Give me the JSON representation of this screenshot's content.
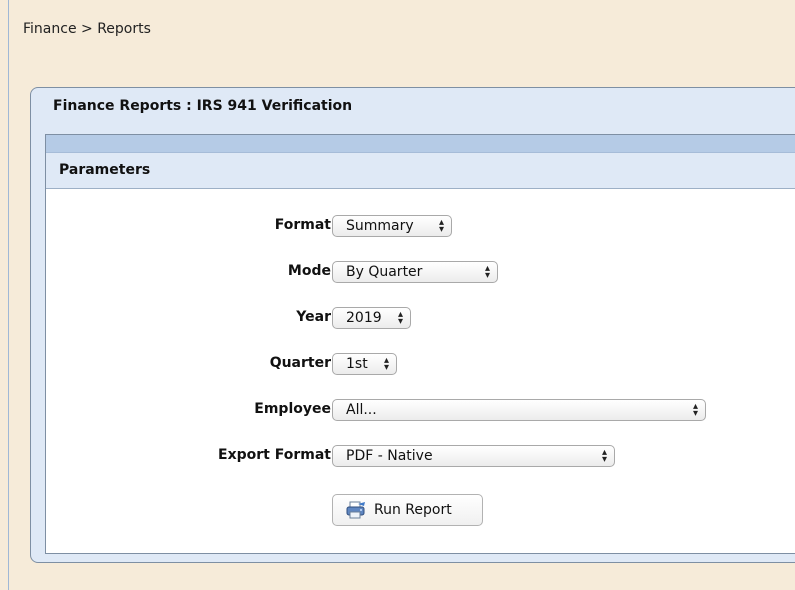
{
  "breadcrumb": "Finance > Reports",
  "panel": {
    "title": "Finance Reports : IRS 941 Verification"
  },
  "section": {
    "title": "Parameters"
  },
  "fields": {
    "format": {
      "label": "Format",
      "value": "Summary"
    },
    "mode": {
      "label": "Mode",
      "value": "By Quarter"
    },
    "year": {
      "label": "Year",
      "value": "2019"
    },
    "quarter": {
      "label": "Quarter",
      "value": "1st"
    },
    "employee": {
      "label": "Employee",
      "value": "All..."
    },
    "export_format": {
      "label": "Export Format",
      "value": "PDF - Native"
    }
  },
  "run_button": {
    "label": "Run Report",
    "icon": "print-report-icon"
  },
  "colors": {
    "page_bg": "#f6ebd9",
    "panel_bg": "#dfe9f6",
    "bar_blue": "#b5cbe6",
    "border": "#7e8fa3"
  }
}
